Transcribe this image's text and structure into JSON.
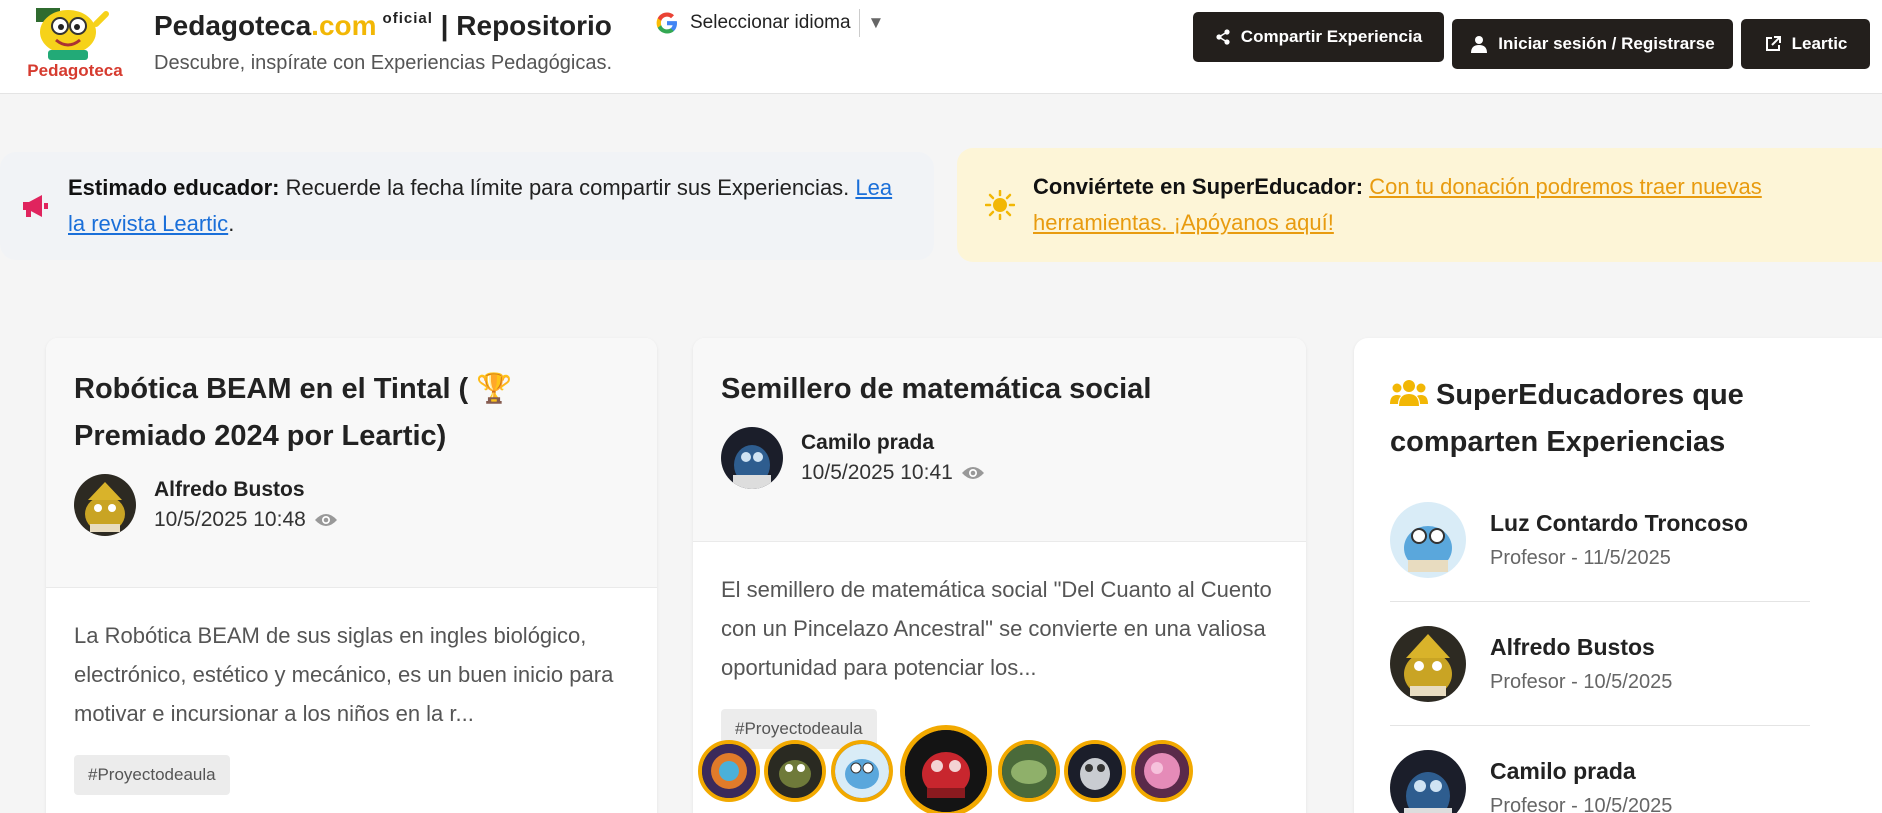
{
  "header": {
    "brand_name": "Pedagoteca",
    "brand_domain": ".com",
    "brand_badge": "oficial",
    "brand_section": "| Repositorio",
    "subtitle": "Descubre, inspírate con Experiencias Pedagógicas.",
    "logo_text": "Pedagoteca",
    "language_selector": "Seleccionar idioma",
    "buttons": {
      "share": "Compartir Experiencia",
      "login": "Iniciar sesión / Registrarse",
      "leartic": "Leartic"
    }
  },
  "notices": {
    "educator": {
      "label": "Estimado educador:",
      "text": " Recuerde la fecha límite para compartir sus Experiencias. ",
      "link": "Lea la revista Leartic",
      "end": "."
    },
    "supereducator": {
      "label": "Conviértete en SuperEducador:",
      "link": "Con tu donación podremos traer nuevas herramientas. ¡Apóyanos aquí!"
    }
  },
  "experiences": [
    {
      "title": "Robótica BEAM en el Tintal ( 🏆 Premiado 2024 por Leartic)",
      "author": "Alfredo Bustos",
      "date": "10/5/2025 10:48",
      "excerpt": "La Robótica BEAM de sus siglas en ingles biológico, electrónico, estético y mecánico, es un buen inicio para motivar e incursionar a los niños en la r...",
      "tag": "#Proyectodeaula"
    },
    {
      "title": "Semillero de matemática social",
      "author": "Camilo prada",
      "date": "10/5/2025 10:41",
      "excerpt": "El semillero de matemática social \"Del Cuanto al Cuento con un Pincelazo Ancestral\" se convierte en una valiosa oportunidad para potenciar los...",
      "tag": "#Proyectodeaula"
    }
  ],
  "sidebar": {
    "title": "SuperEducadores que comparten Experiencias",
    "educators": [
      {
        "name": "Luz Contardo Troncoso",
        "role": "Profesor - 11/5/2025"
      },
      {
        "name": "Alfredo Bustos",
        "role": "Profesor - 10/5/2025"
      },
      {
        "name": "Camilo prada",
        "role": "Profesor - 10/5/2025"
      }
    ]
  },
  "colors": {
    "accent_yellow": "#f2b705",
    "dark_button": "#231f1c",
    "link_blue": "#1a6fd9",
    "link_orange": "#e89b0f",
    "notice_yellow_bg": "#fdf5d7"
  }
}
